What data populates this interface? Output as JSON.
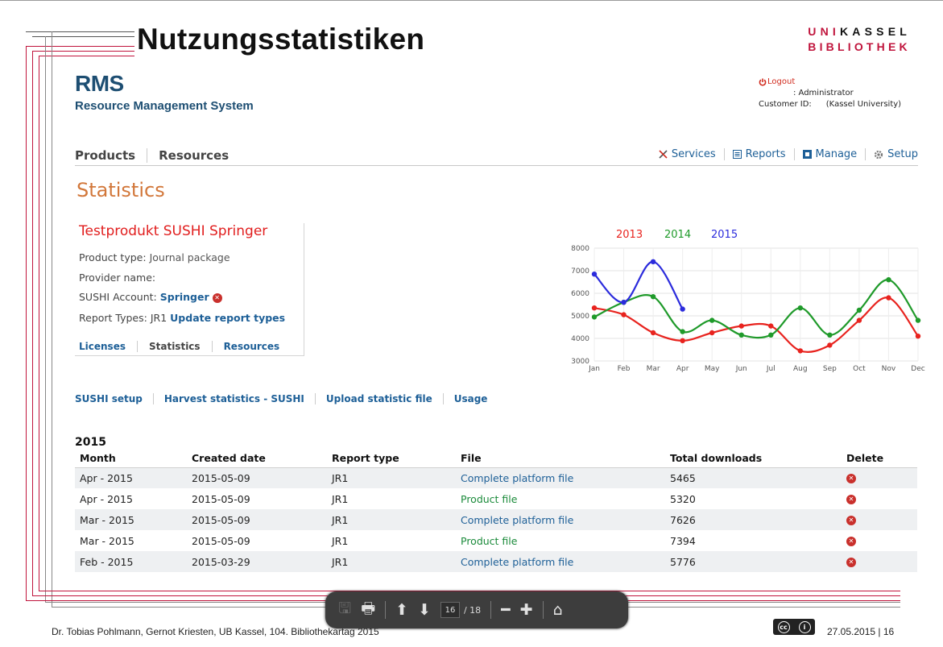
{
  "slide": {
    "title": "Nutzungsstatistiken",
    "logo_line1_uni": "UNI",
    "logo_line1_kassel": "KASSEL",
    "logo_line2": "BIBLIOTHEK"
  },
  "app": {
    "name": "RMS",
    "subtitle": "Resource Management System"
  },
  "user": {
    "logout": "Logout",
    "role": ": Administrator",
    "customer_label": "Customer ID:",
    "customer_value": "(Kassel University)"
  },
  "nav": {
    "left": [
      "Products",
      "Resources"
    ],
    "services": "Services",
    "reports": "Reports",
    "manage": "Manage",
    "setup": "Setup"
  },
  "page": {
    "heading": "Statistics"
  },
  "product": {
    "title": "Testprodukt SUSHI Springer",
    "type_label": "Product type:",
    "type_value": "Journal package",
    "provider_label": "Provider name:",
    "sushi_label": "SUSHI Account:",
    "sushi_value": "Springer",
    "report_types_label": "Report Types:",
    "report_types_value": "JR1",
    "update_link": "Update report types",
    "tabs": [
      "Licenses",
      "Statistics",
      "Resources"
    ]
  },
  "sublinks": [
    "SUSHI setup",
    "Harvest statistics - SUSHI",
    "Upload statistic file",
    "Usage"
  ],
  "table": {
    "year": "2015",
    "headers": [
      "Month",
      "Created date",
      "Report type",
      "File",
      "Total downloads",
      "Delete"
    ],
    "rows": [
      [
        "Apr - 2015",
        "2015-05-09",
        "JR1",
        "Complete platform file",
        "5465"
      ],
      [
        "Apr - 2015",
        "2015-05-09",
        "JR1",
        "Product file",
        "5320"
      ],
      [
        "Mar - 2015",
        "2015-05-09",
        "JR1",
        "Complete platform file",
        "7626"
      ],
      [
        "Mar - 2015",
        "2015-05-09",
        "JR1",
        "Product file",
        "7394"
      ],
      [
        "Feb - 2015",
        "2015-03-29",
        "JR1",
        "Complete platform file",
        "5776"
      ]
    ]
  },
  "chart_data": {
    "type": "line",
    "categories": [
      "Jan",
      "Feb",
      "Mar",
      "Apr",
      "May",
      "Jun",
      "Jul",
      "Aug",
      "Sep",
      "Oct",
      "Nov",
      "Dec"
    ],
    "ylim": [
      3000,
      8000
    ],
    "yticks": [
      3000,
      4000,
      5000,
      6000,
      7000,
      8000
    ],
    "grid": true,
    "legend": "top",
    "series": [
      {
        "name": "2013",
        "color": "#e8231e",
        "values": [
          5350,
          5050,
          4250,
          3900,
          4250,
          4550,
          4550,
          3450,
          3700,
          4800,
          5800,
          4100
        ]
      },
      {
        "name": "2014",
        "color": "#1f9a2a",
        "values": [
          4950,
          5600,
          5850,
          4300,
          4800,
          4150,
          4150,
          5350,
          4150,
          5250,
          6600,
          4800
        ]
      },
      {
        "name": "2015",
        "color": "#2b2bdc",
        "values": [
          6850,
          5600,
          7400,
          5300
        ]
      }
    ]
  },
  "footer": {
    "text": "Dr. Tobias Pohlmann, Gernot Kriesten, UB Kassel, 104. Bibliothekartag 2015",
    "date": "27.05.2015 | 16"
  },
  "pdf": {
    "page": "16",
    "total": "/ 18"
  }
}
